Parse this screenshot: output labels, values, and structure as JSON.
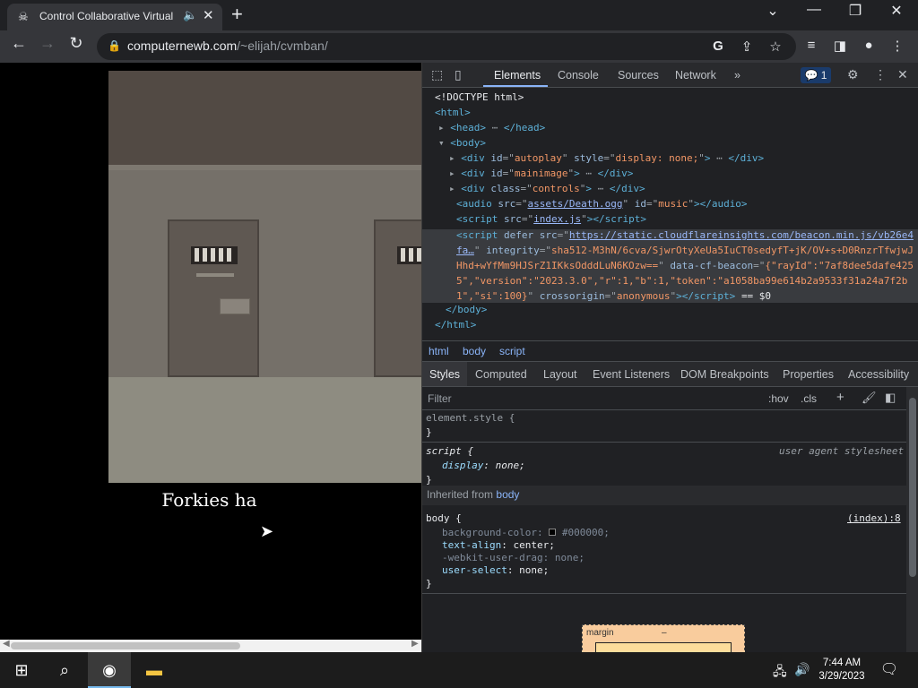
{
  "browser": {
    "tab_title": "Control Collaborative Virtual Ma",
    "url_host": "computernewb.com",
    "url_path": "/~elijah/cvmban/",
    "new_tab": "+",
    "tab_close": "✕"
  },
  "page": {
    "caption": "Forkies ha"
  },
  "devtools": {
    "tabs": [
      "Elements",
      "Console",
      "Sources",
      "Network",
      "»"
    ],
    "issues_count": "1",
    "dom": {
      "doctype": "<!DOCTYPE html>",
      "html_open": "<html>",
      "head": "<head>",
      "head_close": "</head>",
      "body_open": "<body>",
      "div_autoplay_id": "autoplay",
      "div_autoplay_style": "display: none;",
      "div_mainimage_id": "mainimage",
      "div_controls_class": "controls",
      "audio_src": "assets/Death.ogg",
      "audio_id": "music",
      "script_src": "index.js",
      "beacon_src": "https://static.cloudflareinsights.com/beacon.min.js/vb26e4fa…",
      "beacon_integrity": "sha512-M3hN/6cva/SjwrOtyXeUa5IuCT0sedyfT+jK/OV+s+D0RnzrTfwjwJHhd+wYfMm9HJSrZ1IKksOdddLuN6KOzw==",
      "beacon_cf": "{\"rayId\":\"7af8dee5dafe4255\",\"version\":\"2023.3.0\",\"r\":1,\"b\":1,\"token\":\"a1058ba99e614b2a9533f31a24a7f2b1\",\"si\":100}",
      "beacon_crossorigin": "anonymous",
      "selected_marker": "== $0",
      "body_close": "</body>",
      "html_close": "</html>"
    },
    "breadcrumbs": [
      "html",
      "body",
      "script"
    ],
    "style_tabs": [
      "Styles",
      "Computed",
      "Layout",
      "Event Listeners",
      "DOM Breakpoints",
      "Properties",
      "Accessibility"
    ],
    "filter_placeholder": "Filter",
    "filter_hov": ":hov",
    "filter_cls": ".cls",
    "rules": {
      "element_style": "element.style {",
      "close_brace": "}",
      "script_selector": "script {",
      "ua_label": "user agent stylesheet",
      "script_prop": "display",
      "script_val": "none;",
      "inherited_from": "Inherited from",
      "inherited_el": "body",
      "body_selector": "body {",
      "body_source": "(index):8",
      "bg_prop": "background-color",
      "bg_val": "#000000;",
      "align_prop": "text-align",
      "align_val": "center;",
      "drag_prop": "-webkit-user-drag",
      "drag_val": "none;",
      "select_prop": "user-select",
      "select_val": "none;"
    },
    "boxmodel_label": "margin",
    "boxmodel_value": "–"
  },
  "taskbar": {
    "time": "7:44 AM",
    "date": "3/29/2023"
  },
  "colors": {
    "accent": "#8ab4f8",
    "devtools_bg": "#202124",
    "chrome_bg": "#35363a"
  }
}
